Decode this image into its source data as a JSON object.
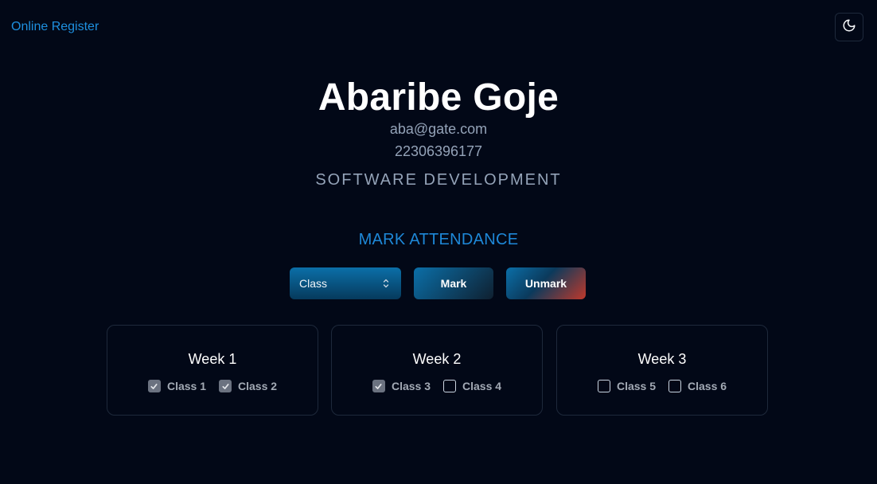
{
  "nav": {
    "brand": "Online Register",
    "theme_toggle_icon": "moon-icon"
  },
  "profile": {
    "name": "Abaribe Goje",
    "email": "aba@gate.com",
    "id_number": "22306396177",
    "department": "SOFTWARE DEVELOPMENT"
  },
  "attendance": {
    "title": "MARK ATTENDANCE",
    "select_value": "Class",
    "mark_label": "Mark",
    "unmark_label": "Unmark"
  },
  "weeks": [
    {
      "title": "Week 1",
      "classes": [
        {
          "label": "Class 1",
          "checked": true
        },
        {
          "label": "Class 2",
          "checked": true
        }
      ]
    },
    {
      "title": "Week 2",
      "classes": [
        {
          "label": "Class 3",
          "checked": true
        },
        {
          "label": "Class 4",
          "checked": false
        }
      ]
    },
    {
      "title": "Week 3",
      "classes": [
        {
          "label": "Class 5",
          "checked": false
        },
        {
          "label": "Class 6",
          "checked": false
        }
      ]
    }
  ],
  "colors": {
    "background": "#020817",
    "brand": "#1e90e0",
    "accent": "#1e88d8",
    "muted_text": "#94a3b8",
    "unmark_gradient_end": "#c0392b"
  }
}
